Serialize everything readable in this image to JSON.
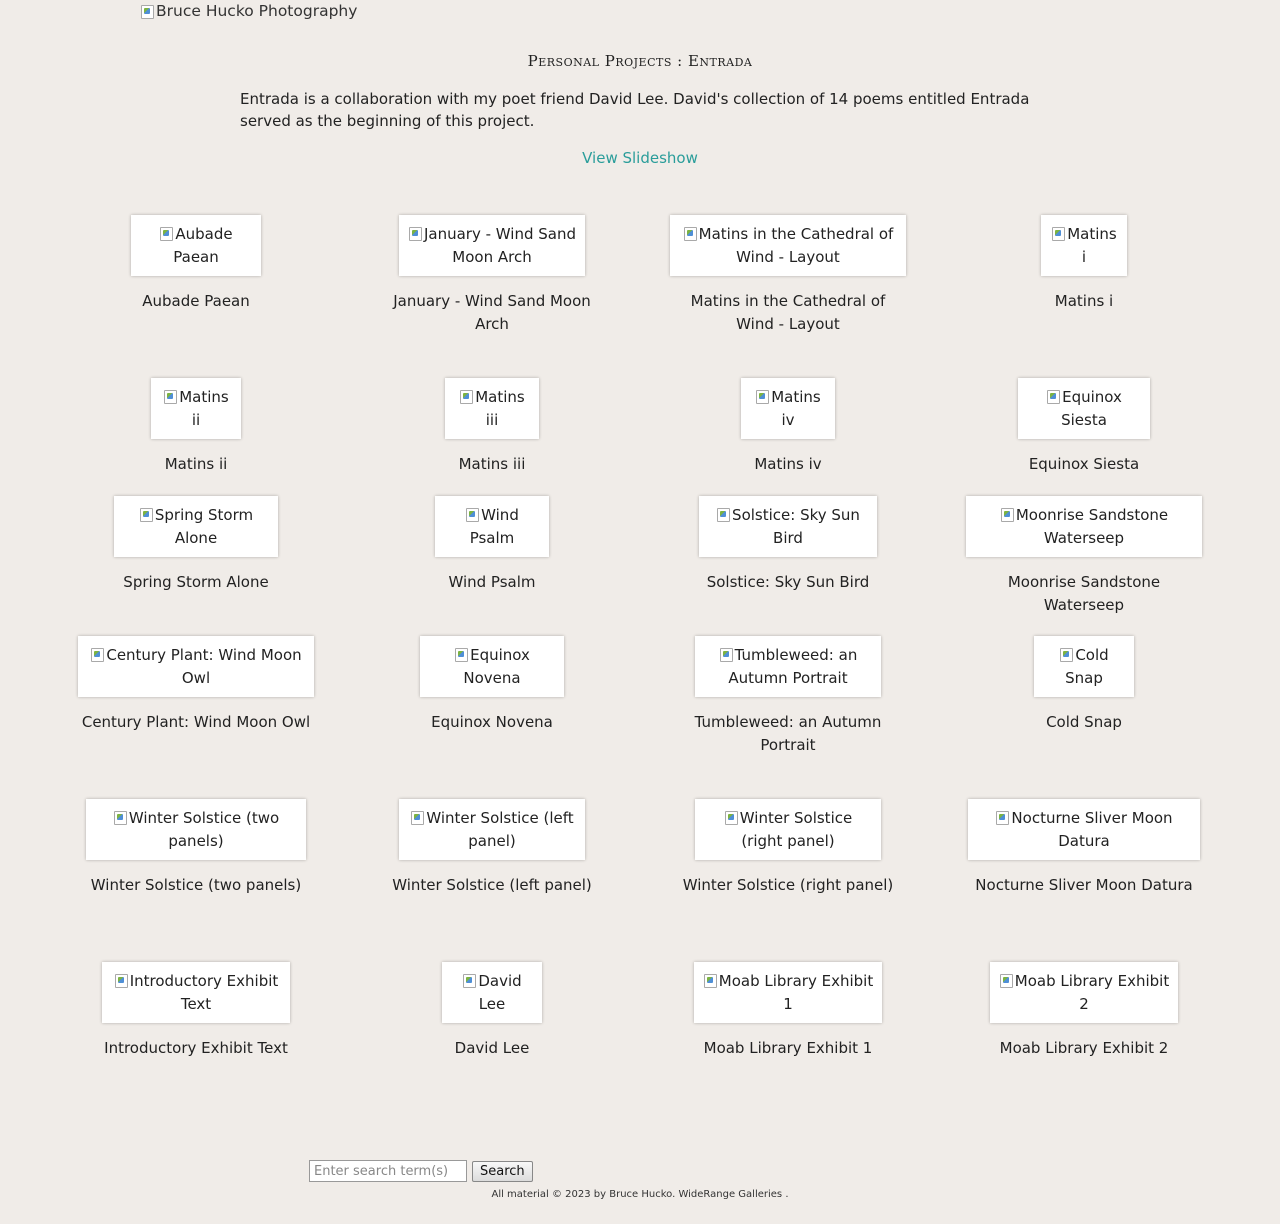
{
  "header": {
    "logo_alt": "Bruce Hucko Photography",
    "logo_icon": "broken-image-icon"
  },
  "page": {
    "title": "Personal Projects : Entrada",
    "intro": "Entrada is a collaboration with my poet friend David Lee. David's collection of 14 poems entitled Entrada served as the beginning of this project.",
    "slideshow_link": "View Slideshow"
  },
  "gallery": [
    {
      "alt": "Aubade Paean",
      "caption": "Aubade Paean"
    },
    {
      "alt": "January - Wind Sand Moon Arch",
      "caption": "January - Wind Sand Moon Arch"
    },
    {
      "alt": "Matins in the Cathedral of Wind - Layout",
      "caption": "Matins in the Cathedral of Wind - Layout"
    },
    {
      "alt": "Matins i",
      "caption": "Matins i"
    },
    {
      "alt": "Matins ii",
      "caption": "Matins ii"
    },
    {
      "alt": "Matins iii",
      "caption": "Matins iii"
    },
    {
      "alt": "Matins iv",
      "caption": "Matins iv"
    },
    {
      "alt": "Equinox Siesta",
      "caption": "Equinox Siesta"
    },
    {
      "alt": "Spring Storm Alone",
      "caption": "Spring Storm Alone"
    },
    {
      "alt": "Wind Psalm",
      "caption": "Wind Psalm"
    },
    {
      "alt": "Solstice: Sky Sun Bird",
      "caption": "Solstice: Sky Sun Bird"
    },
    {
      "alt": "Moonrise Sandstone Waterseep",
      "caption": "Moonrise Sandstone Waterseep"
    },
    {
      "alt": "Century Plant: Wind Moon Owl",
      "caption": "Century Plant: Wind Moon Owl"
    },
    {
      "alt": "Equinox Novena",
      "caption": "Equinox Novena"
    },
    {
      "alt": "Tumbleweed: an Autumn Portrait",
      "caption": "Tumbleweed: an Autumn Portrait"
    },
    {
      "alt": "Cold Snap",
      "caption": "Cold Snap"
    },
    {
      "alt": "Winter Solstice (two panels)",
      "caption": "Winter Solstice (two panels)"
    },
    {
      "alt": "Winter Solstice (left panel)",
      "caption": "Winter Solstice (left panel)"
    },
    {
      "alt": "Winter Solstice (right panel)",
      "caption": "Winter Solstice (right panel)"
    },
    {
      "alt": "Nocturne Sliver Moon Datura",
      "caption": "Nocturne Sliver Moon Datura"
    },
    {
      "alt": "Introductory Exhibit Text",
      "caption": "Introductory Exhibit Text"
    },
    {
      "alt": "David Lee",
      "caption": "David Lee"
    },
    {
      "alt": "Moab Library Exhibit 1",
      "caption": "Moab Library Exhibit 1"
    },
    {
      "alt": "Moab Library Exhibit 2",
      "caption": "Moab Library Exhibit 2"
    }
  ],
  "search": {
    "placeholder": "Enter search term(s)",
    "value": "",
    "button_label": "Search"
  },
  "footer": {
    "copyright": "All material © 2023 by Bruce Hucko.",
    "link": "WideRange Galleries",
    "trailing": "."
  },
  "colors": {
    "background": "#f0ece8",
    "link": "#2a9d9a"
  }
}
